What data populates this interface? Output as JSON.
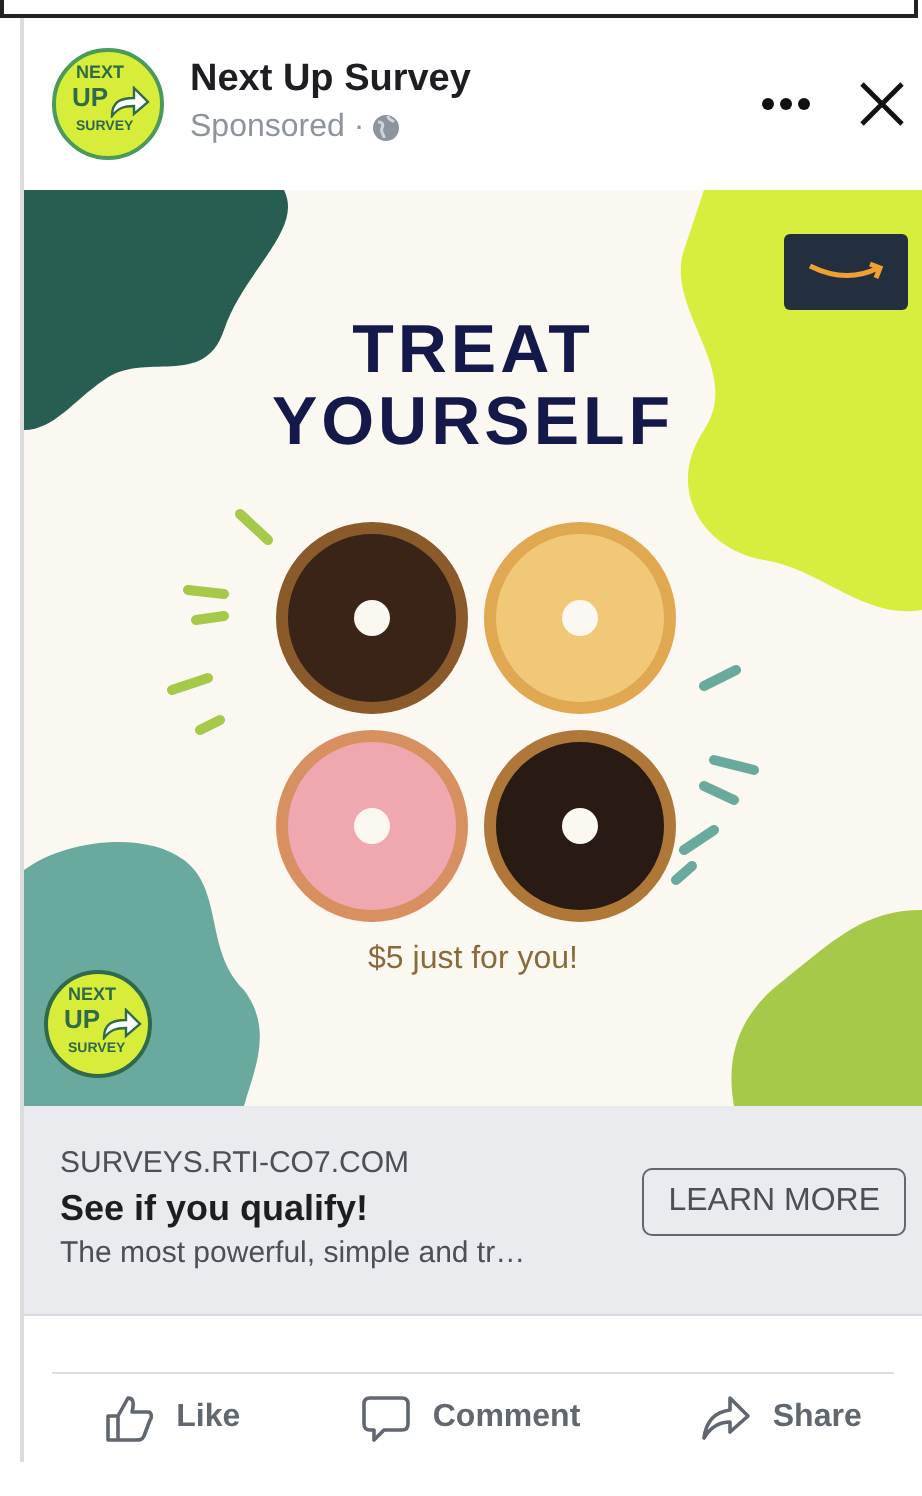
{
  "post": {
    "page_name": "Next Up Survey",
    "subtitle": "Sponsored ·",
    "avatar_logo": [
      "NEXT",
      "UP",
      "SURVEY"
    ]
  },
  "creative": {
    "headline": [
      "TREAT",
      "YOURSELF"
    ],
    "offer": "$5 just for you!",
    "corner_logo": [
      "NEXT",
      "UP",
      "SURVEY"
    ]
  },
  "link": {
    "domain": "SURVEYS.RTI-CO7.COM",
    "title": "See if you qualify!",
    "description": "The most powerful, simple and tr…",
    "button": "LEARN MORE"
  },
  "actions": [
    {
      "kind": "like",
      "label": "Like"
    },
    {
      "kind": "comment",
      "label": "Comment"
    },
    {
      "kind": "share",
      "label": "Share"
    }
  ]
}
